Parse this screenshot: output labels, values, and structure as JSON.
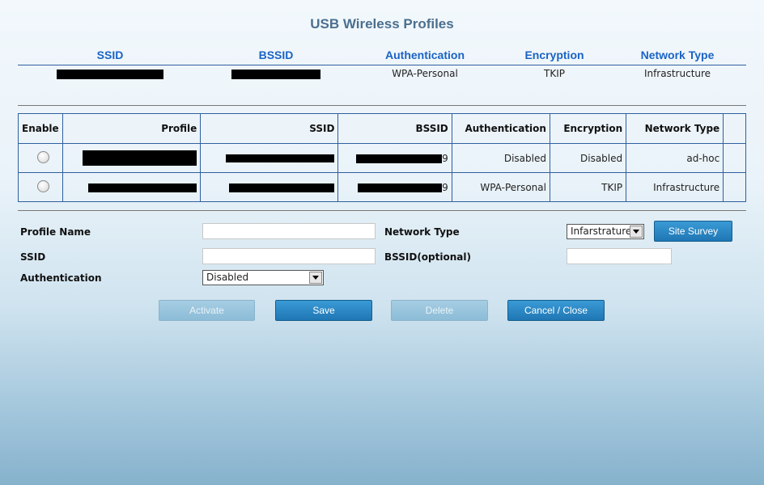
{
  "title": "USB Wireless Profiles",
  "current": {
    "headers": [
      "SSID",
      "BSSID",
      "Authentication",
      "Encryption",
      "Network Type"
    ],
    "authentication": "WPA-Personal",
    "encryption": "TKIP",
    "network_type": "Infrastructure"
  },
  "profiles_table": {
    "headers": {
      "enable": "Enable",
      "profile": "Profile",
      "ssid": "SSID",
      "bssid": "BSSID",
      "authentication": "Authentication",
      "encryption": "Encryption",
      "network_type": "Network Type"
    },
    "rows": [
      {
        "authentication": "Disabled",
        "encryption": "Disabled",
        "network_type": "ad-hoc",
        "bssid_tail": "9"
      },
      {
        "authentication": "WPA-Personal",
        "encryption": "TKIP",
        "network_type": "Infrastructure",
        "bssid_tail": "9"
      }
    ]
  },
  "form": {
    "profile_name_label": "Profile Name",
    "ssid_label": "SSID",
    "authentication_label": "Authentication",
    "authentication_value": "Disabled",
    "network_type_label": "Network Type",
    "network_type_value": "Infarstrature",
    "bssid_label": "BSSID(optional)",
    "profile_name_value": "",
    "ssid_value": "",
    "bssid_value": ""
  },
  "buttons": {
    "site_survey": "Site Survey",
    "activate": "Activate",
    "save": "Save",
    "delete": "Delete",
    "cancel_close": "Cancel / Close"
  }
}
